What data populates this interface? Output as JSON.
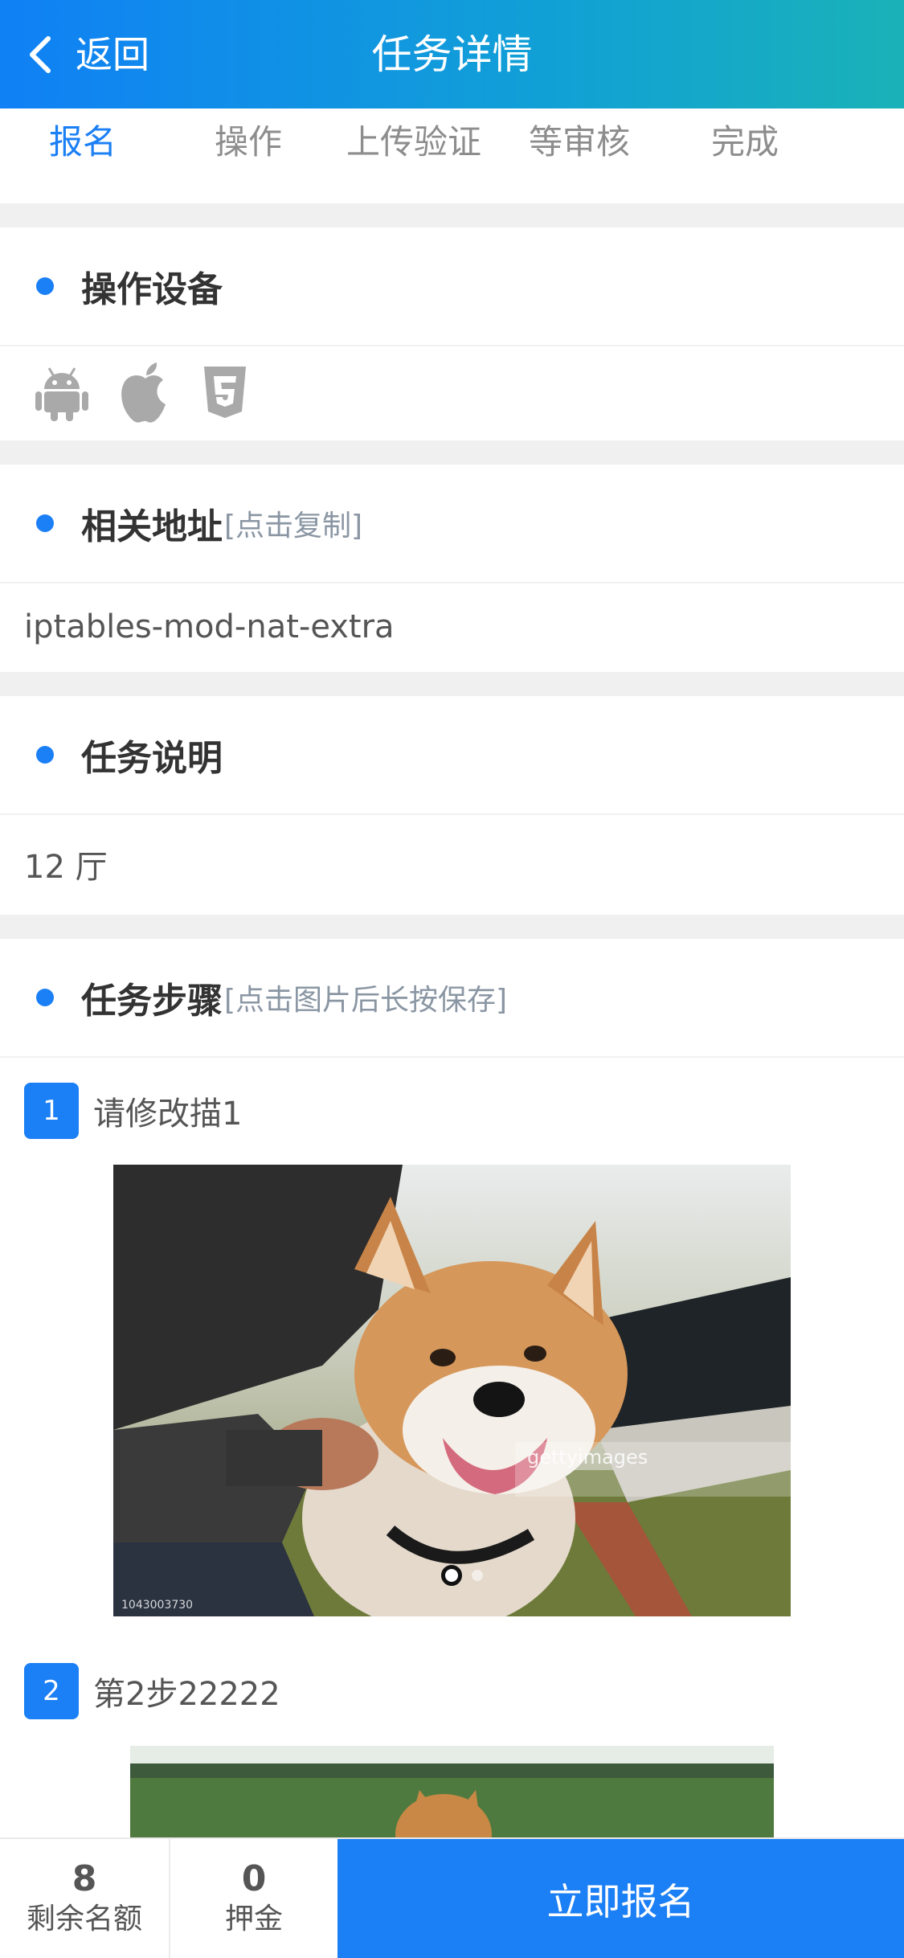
{
  "header": {
    "back_label": "返回",
    "title": "任务详情"
  },
  "tabs": [
    {
      "label": "报名",
      "active": true
    },
    {
      "label": "操作",
      "active": false
    },
    {
      "label": "上传验证",
      "active": false
    },
    {
      "label": "等审核",
      "active": false
    },
    {
      "label": "完成",
      "active": false
    }
  ],
  "devices": {
    "title": "操作设备",
    "icons": [
      "android-icon",
      "apple-icon",
      "html5-icon"
    ]
  },
  "address": {
    "title": "相关地址",
    "note": "[点击复制]",
    "value": "iptables-mod-nat-extra"
  },
  "description": {
    "title": "任务说明",
    "value": "12 厅"
  },
  "steps": {
    "title": "任务步骤",
    "note": "[点击图片后长按保存]",
    "items": [
      {
        "num": "1",
        "text": "请修改描1"
      },
      {
        "num": "2",
        "text": "第2步22222"
      }
    ],
    "watermark_brand": "gettyimages",
    "watermark_id": "1043003730"
  },
  "bottom": {
    "remaining_value": "8",
    "remaining_label": "剩余名额",
    "deposit_value": "0",
    "deposit_label": "押金",
    "cta_label": "立即报名"
  },
  "colors": {
    "primary": "#1b7ff5",
    "header_gradient_start": "#1080f5",
    "header_gradient_end": "#1ab2b8",
    "muted_text": "#8d8d8d"
  }
}
